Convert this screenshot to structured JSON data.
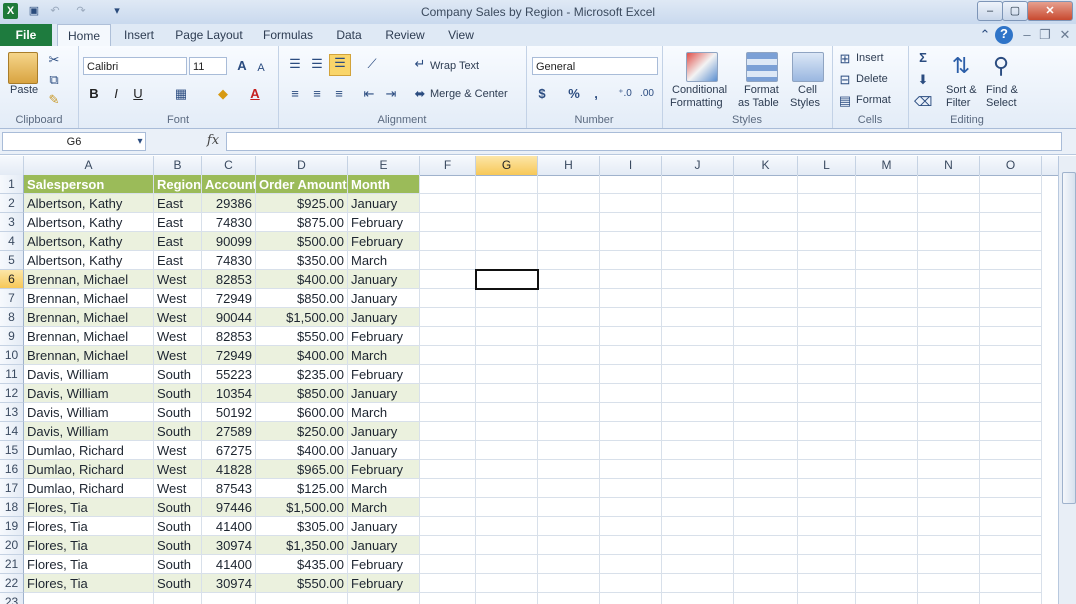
{
  "window": {
    "title": "Company Sales by Region - Microsoft Excel"
  },
  "tabs": [
    "File",
    "Home",
    "Insert",
    "Page Layout",
    "Formulas",
    "Data",
    "Review",
    "View"
  ],
  "ribbon": {
    "clipboard": {
      "paste": "Paste",
      "label": "Clipboard"
    },
    "font": {
      "name": "Calibri",
      "size": "11",
      "label": "Font",
      "bold": "B",
      "italic": "I",
      "underline": "U"
    },
    "alignment": {
      "wrap": "Wrap Text",
      "merge": "Merge & Center",
      "label": "Alignment"
    },
    "number": {
      "format": "General",
      "currency": "$",
      "percent": "%",
      "comma": ",",
      "label": "Number"
    },
    "styles": {
      "conditional_1": "Conditional",
      "conditional_2": "Formatting",
      "format_table_1": "Format",
      "format_table_2": "as Table",
      "cell_styles_1": "Cell",
      "cell_styles_2": "Styles",
      "label": "Styles"
    },
    "cells": {
      "insert": "Insert",
      "delete": "Delete",
      "format": "Format",
      "label": "Cells"
    },
    "editing": {
      "sort_1": "Sort &",
      "sort_2": "Filter",
      "find_1": "Find &",
      "find_2": "Select",
      "label": "Editing"
    }
  },
  "formula_bar": {
    "name_box": "G6",
    "fx": "fx",
    "value": ""
  },
  "columns": [
    "A",
    "B",
    "C",
    "D",
    "E",
    "F",
    "G",
    "H",
    "I",
    "J",
    "K",
    "L",
    "M",
    "N",
    "O"
  ],
  "selected_cell": "G6",
  "headers": [
    "Salesperson",
    "Region",
    "Account",
    "Order Amount",
    "Month"
  ],
  "rows": [
    [
      "Albertson, Kathy",
      "East",
      "29386",
      "$925.00",
      "January"
    ],
    [
      "Albertson, Kathy",
      "East",
      "74830",
      "$875.00",
      "February"
    ],
    [
      "Albertson, Kathy",
      "East",
      "90099",
      "$500.00",
      "February"
    ],
    [
      "Albertson, Kathy",
      "East",
      "74830",
      "$350.00",
      "March"
    ],
    [
      "Brennan, Michael",
      "West",
      "82853",
      "$400.00",
      "January"
    ],
    [
      "Brennan, Michael",
      "West",
      "72949",
      "$850.00",
      "January"
    ],
    [
      "Brennan, Michael",
      "West",
      "90044",
      "$1,500.00",
      "January"
    ],
    [
      "Brennan, Michael",
      "West",
      "82853",
      "$550.00",
      "February"
    ],
    [
      "Brennan, Michael",
      "West",
      "72949",
      "$400.00",
      "March"
    ],
    [
      "Davis, William",
      "South",
      "55223",
      "$235.00",
      "February"
    ],
    [
      "Davis, William",
      "South",
      "10354",
      "$850.00",
      "January"
    ],
    [
      "Davis, William",
      "South",
      "50192",
      "$600.00",
      "March"
    ],
    [
      "Davis, William",
      "South",
      "27589",
      "$250.00",
      "January"
    ],
    [
      "Dumlao, Richard",
      "West",
      "67275",
      "$400.00",
      "January"
    ],
    [
      "Dumlao, Richard",
      "West",
      "41828",
      "$965.00",
      "February"
    ],
    [
      "Dumlao, Richard",
      "West",
      "87543",
      "$125.00",
      "March"
    ],
    [
      "Flores, Tia",
      "South",
      "97446",
      "$1,500.00",
      "March"
    ],
    [
      "Flores, Tia",
      "South",
      "41400",
      "$305.00",
      "January"
    ],
    [
      "Flores, Tia",
      "South",
      "30974",
      "$1,350.00",
      "January"
    ],
    [
      "Flores, Tia",
      "South",
      "41400",
      "$435.00",
      "February"
    ],
    [
      "Flores, Tia",
      "South",
      "30974",
      "$550.00",
      "February"
    ]
  ],
  "colors": {
    "header_fill": "#9bbb59",
    "band_fill": "#ebf1de",
    "file_tab": "#1e7b3e",
    "selected_header": "#f7c858"
  }
}
